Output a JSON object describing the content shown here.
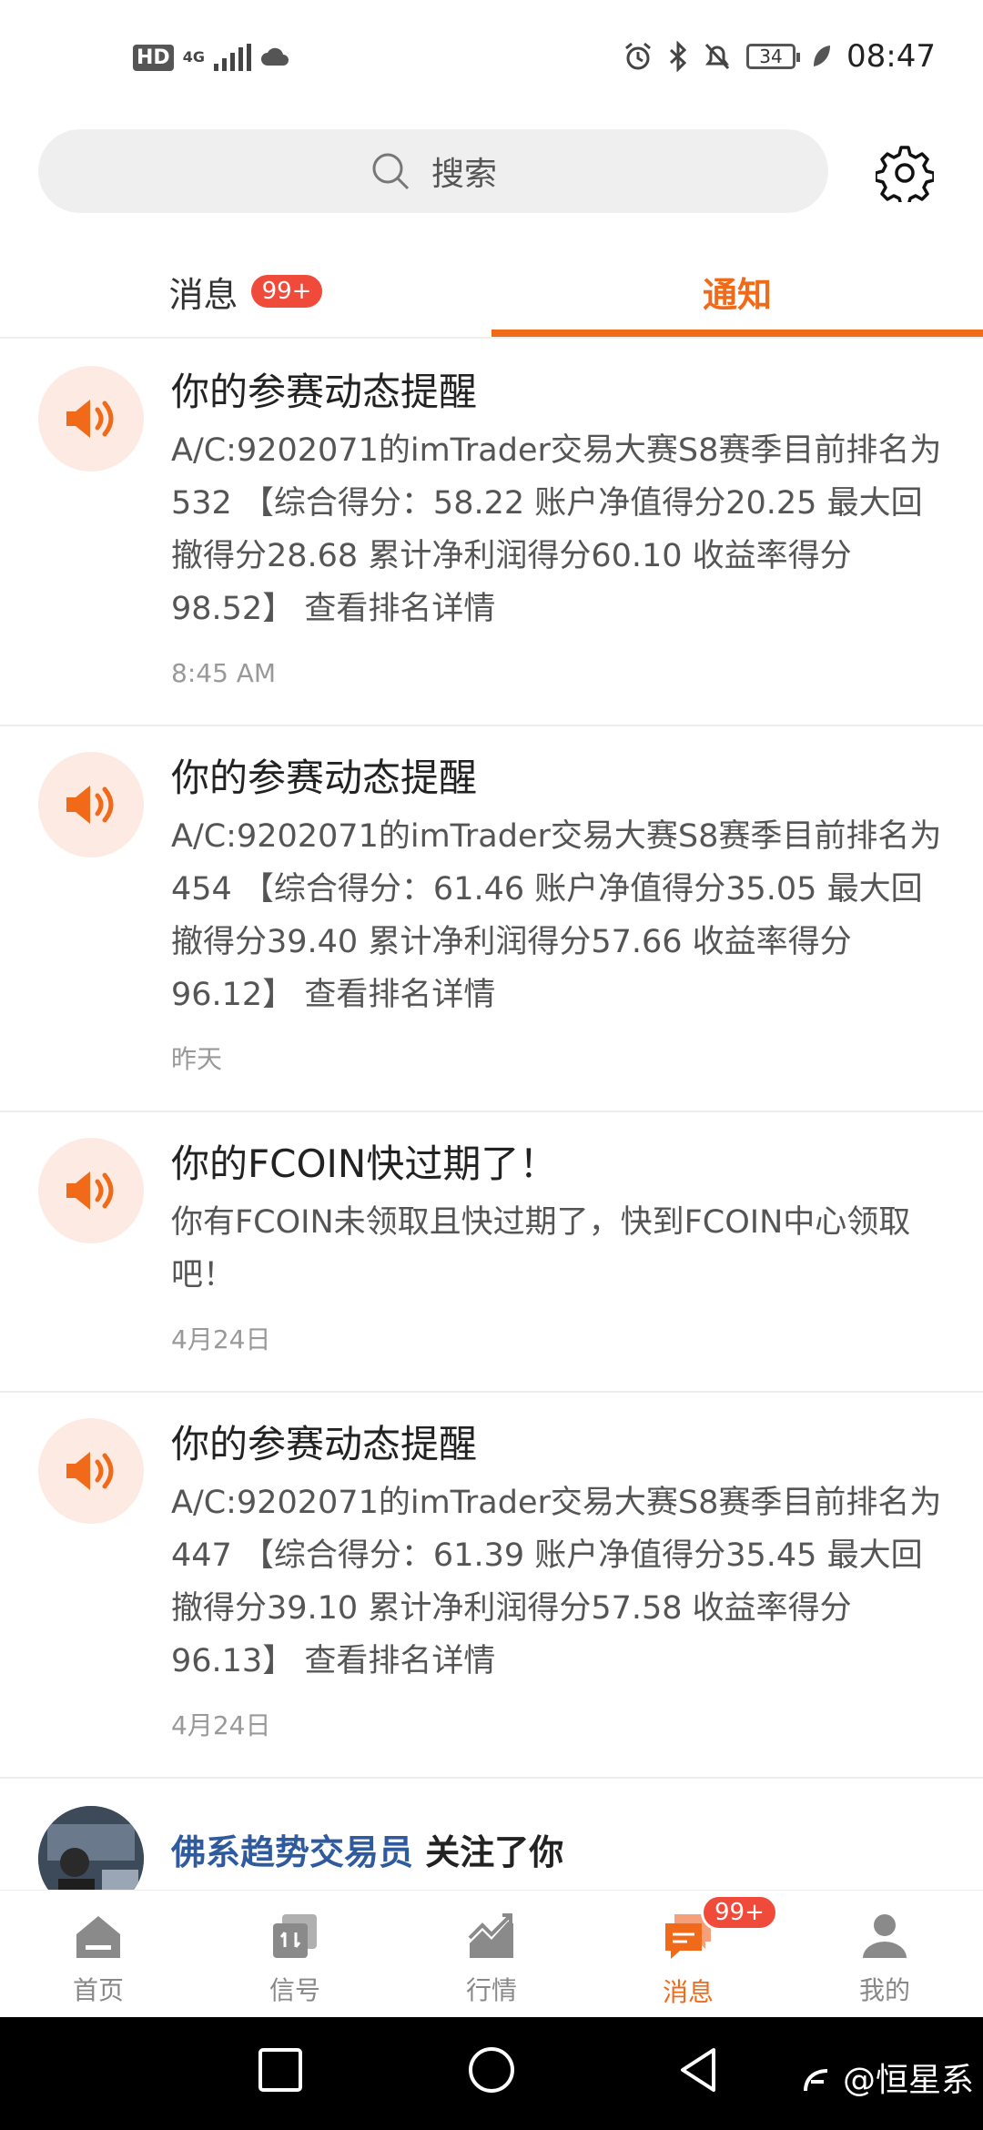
{
  "status_bar": {
    "hd": "HD",
    "network": "4G",
    "battery": "34",
    "time": "08:47"
  },
  "search": {
    "placeholder": "搜索"
  },
  "tabs": {
    "messages_label": "消息",
    "messages_badge": "99+",
    "notices_label": "通知",
    "active": "通知"
  },
  "notices": [
    {
      "title": "你的参赛动态提醒",
      "body": "A/C:9202071的imTrader交易大赛S8赛季目前排名为532 【综合得分：58.22 账户净值得分20.25 最大回撤得分28.68 累计净利润得分60.10 收益率得分98.52】 查看排名详情",
      "time": "8:45 AM"
    },
    {
      "title": "你的参赛动态提醒",
      "body": "A/C:9202071的imTrader交易大赛S8赛季目前排名为454 【综合得分：61.46 账户净值得分35.05 最大回撤得分39.40 累计净利润得分57.66 收益率得分96.12】 查看排名详情",
      "time": "昨天"
    },
    {
      "title": "你的FCOIN快过期了！",
      "body": "你有FCOIN未领取且快过期了，快到FCOIN中心领取吧！",
      "time": "4月24日"
    },
    {
      "title": "你的参赛动态提醒",
      "body": "A/C:9202071的imTrader交易大赛S8赛季目前排名为447 【综合得分：61.39 账户净值得分35.45 最大回撤得分39.10 累计净利润得分57.58 收益率得分96.13】 查看排名详情",
      "time": "4月24日"
    }
  ],
  "follow": {
    "name": "佛系趋势交易员",
    "action": "关注了你"
  },
  "bottom_nav": {
    "items": [
      {
        "label": "首页",
        "icon": "home-icon"
      },
      {
        "label": "信号",
        "icon": "signal-icon"
      },
      {
        "label": "行情",
        "icon": "market-chart-icon"
      },
      {
        "label": "消息",
        "icon": "message-icon",
        "badge": "99+"
      },
      {
        "label": "我的",
        "icon": "profile-icon"
      }
    ],
    "active": "消息"
  },
  "watermark": "@恒星系",
  "colors": {
    "accent": "#f06a1a",
    "badge": "#f04a3a",
    "icon_bg": "#fdebe3",
    "link_name": "#2f5b9e"
  }
}
